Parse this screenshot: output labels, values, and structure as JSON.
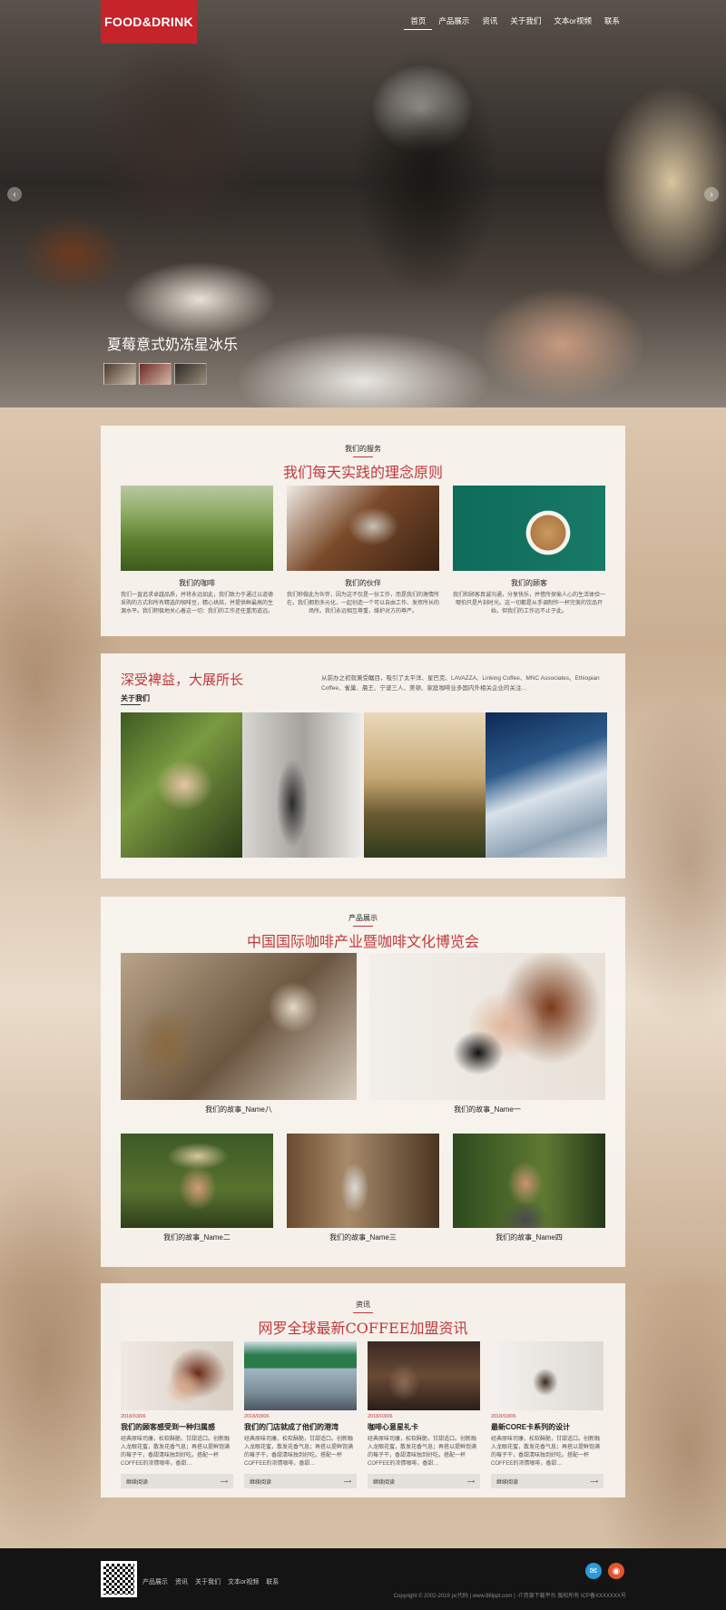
{
  "header": {
    "logo": "FOOD&DRINK",
    "nav": [
      "首页",
      "产品展示",
      "资讯",
      "关于我们",
      "文本or视频",
      "联系"
    ],
    "hero_caption": "夏莓意式奶冻星冰乐",
    "prev_icon": "chevron-left-icon",
    "next_icon": "chevron-right-icon"
  },
  "services": {
    "small": "我们的服务",
    "big": "我们每天实践的理念原则",
    "items": [
      {
        "title": "我们的咖啡",
        "desc": "我们一直追求卓越品质，并将永远如此，我们致力于通过以道德采购的方式和所有精选的咖啡豆，精心烘焙，并提供鲜最高的生源水平。我们积极地关心着这一切：我们的工作还任重而道远。"
      },
      {
        "title": "我们的伙伴",
        "desc": "我们称做此为伙伴，因为这不仅是一份工作，而是我们的激情所在。我们拥抱多元化，一起创造一个可以自由工作、发挥所长的场所。我们永远相互尊重，维护对方的尊严。"
      },
      {
        "title": "我们的顾客",
        "desc": "我们和顾客真诚沟通，分享快乐，并借所探偷人心的生活体验一哪怕只是片刻时光。这一切都是从手调制作一杯完美的饮品开始，但我们的工作远不止于此。"
      }
    ]
  },
  "about": {
    "heading": "深受裨益，大展所长",
    "sub": "关于我们",
    "text": "从前办之初就兼受瞩目，吸引了太平洋、星巴克、LAVAZZA、Linking Coffee、MNC Associates、Ethiopian Coffee、雀巢、晨王、宁波三人、美顿、家庭咖啡业多国内外相关企业的关注…"
  },
  "products": {
    "small": "产品展示",
    "big": "中国国际咖啡产业暨咖啡文化博览会",
    "items": [
      "我们的故事_Name八",
      "我们的故事_Name一",
      "我们的故事_Name二",
      "我们的故事_Name三",
      "我们的故事_Name四"
    ]
  },
  "news": {
    "small": "资讯",
    "big": "网罗全球最新COFFEE加盟资讯",
    "items": [
      {
        "date": "2018/03/06",
        "title": "我们的顾客感受到一种归属感",
        "desc": "经典原味司康，松软酥脆，甘甜适口。创新融入龙眼花蜜，散发花香气息；再搭以提鲜饱满的莓子干，香甜清味独到好吃。搭配一杯COFFEE的浓情咖啡，香甜…",
        "more": "继续阅读"
      },
      {
        "date": "2018/03/06",
        "title": "我们的门店就成了他们的港湾",
        "desc": "经典原味司康，松软酥脆，甘甜适口。创新融入龙眼花蜜，散发花香气息；再搭以提鲜饱满的莓子干，香甜清味独到好吃。搭配一杯COFFEE的浓情咖啡，香甜…",
        "more": "继续阅读"
      },
      {
        "date": "2018/03/06",
        "title": "咖啡心意星礼卡",
        "desc": "经典原味司康，松软酥脆，甘甜适口。创新融入龙眼花蜜，散发花香气息；再搭以提鲜饱满的莓子干，香甜清味独到好吃。搭配一杯COFFEE的浓情咖啡，香甜…",
        "more": "继续阅读"
      },
      {
        "date": "2018/03/06",
        "title": "最新CORE卡系列的设计",
        "desc": "经典原味司康，松软酥脆，甘甜适口。创新融入龙眼花蜜，散发花香气息；再搭以提鲜饱满的莓子干，香甜清味独到好吃。搭配一杯COFFEE的浓情咖啡，香甜…",
        "more": "继续阅读"
      }
    ]
  },
  "footer": {
    "links": [
      "产品展示",
      "资讯",
      "关于我们",
      "文本or视频",
      "联系"
    ],
    "copyright": "Copyright © 2002-2019 pc代码 | www.86lppt.com | -IT资源下载平台 版权所有 ICP备XXXXXXX号"
  }
}
